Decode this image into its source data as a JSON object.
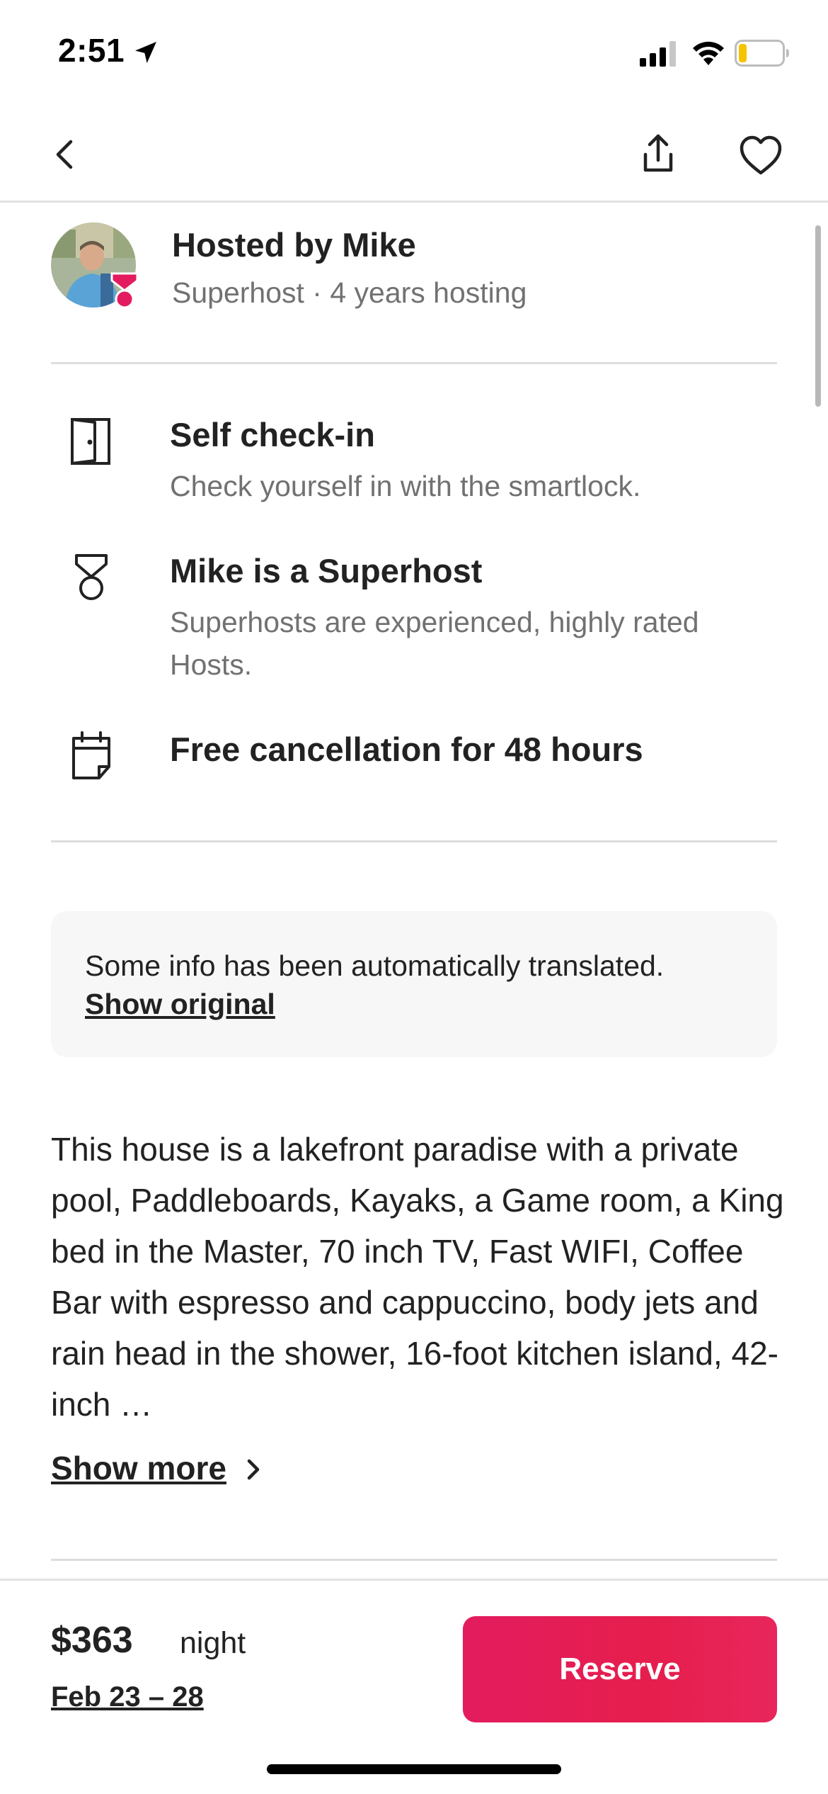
{
  "status_bar": {
    "time": "2:51",
    "battery_color": "#f5c400"
  },
  "nav": {
    "back_icon": "chevron-left-icon",
    "share_icon": "share-icon",
    "save_icon": "heart-icon"
  },
  "host": {
    "title": "Hosted by Mike",
    "subtitle": "Superhost · 4 years hosting",
    "badge_color": "#e31c5f"
  },
  "highlights": [
    {
      "icon": "door-icon",
      "title": "Self check-in",
      "description": "Check yourself in with the smartlock."
    },
    {
      "icon": "superhost-medal-icon",
      "title": "Mike is a Superhost",
      "description": "Superhosts are experienced, highly rated Hosts."
    },
    {
      "icon": "calendar-icon",
      "title": "Free cancellation for 48 hours",
      "description": ""
    }
  ],
  "translation": {
    "notice": "Some info has been automatically translated.",
    "link": "Show original"
  },
  "description": {
    "text": "This house is a lakefront paradise with a private pool, Paddleboards, Kayaks, a Game room, a King bed in the Master,   70 inch TV, Fast WIFI, Coffee Bar with espresso and cappuccino, body jets and rain head in the shower, 16-foot kitchen island, 42-inch …",
    "show_more": "Show more"
  },
  "footer": {
    "price": "$363",
    "price_unit": "night",
    "dates": "Feb 23 – 28",
    "reserve_label": "Reserve",
    "accent_color": "#e61e4d"
  }
}
